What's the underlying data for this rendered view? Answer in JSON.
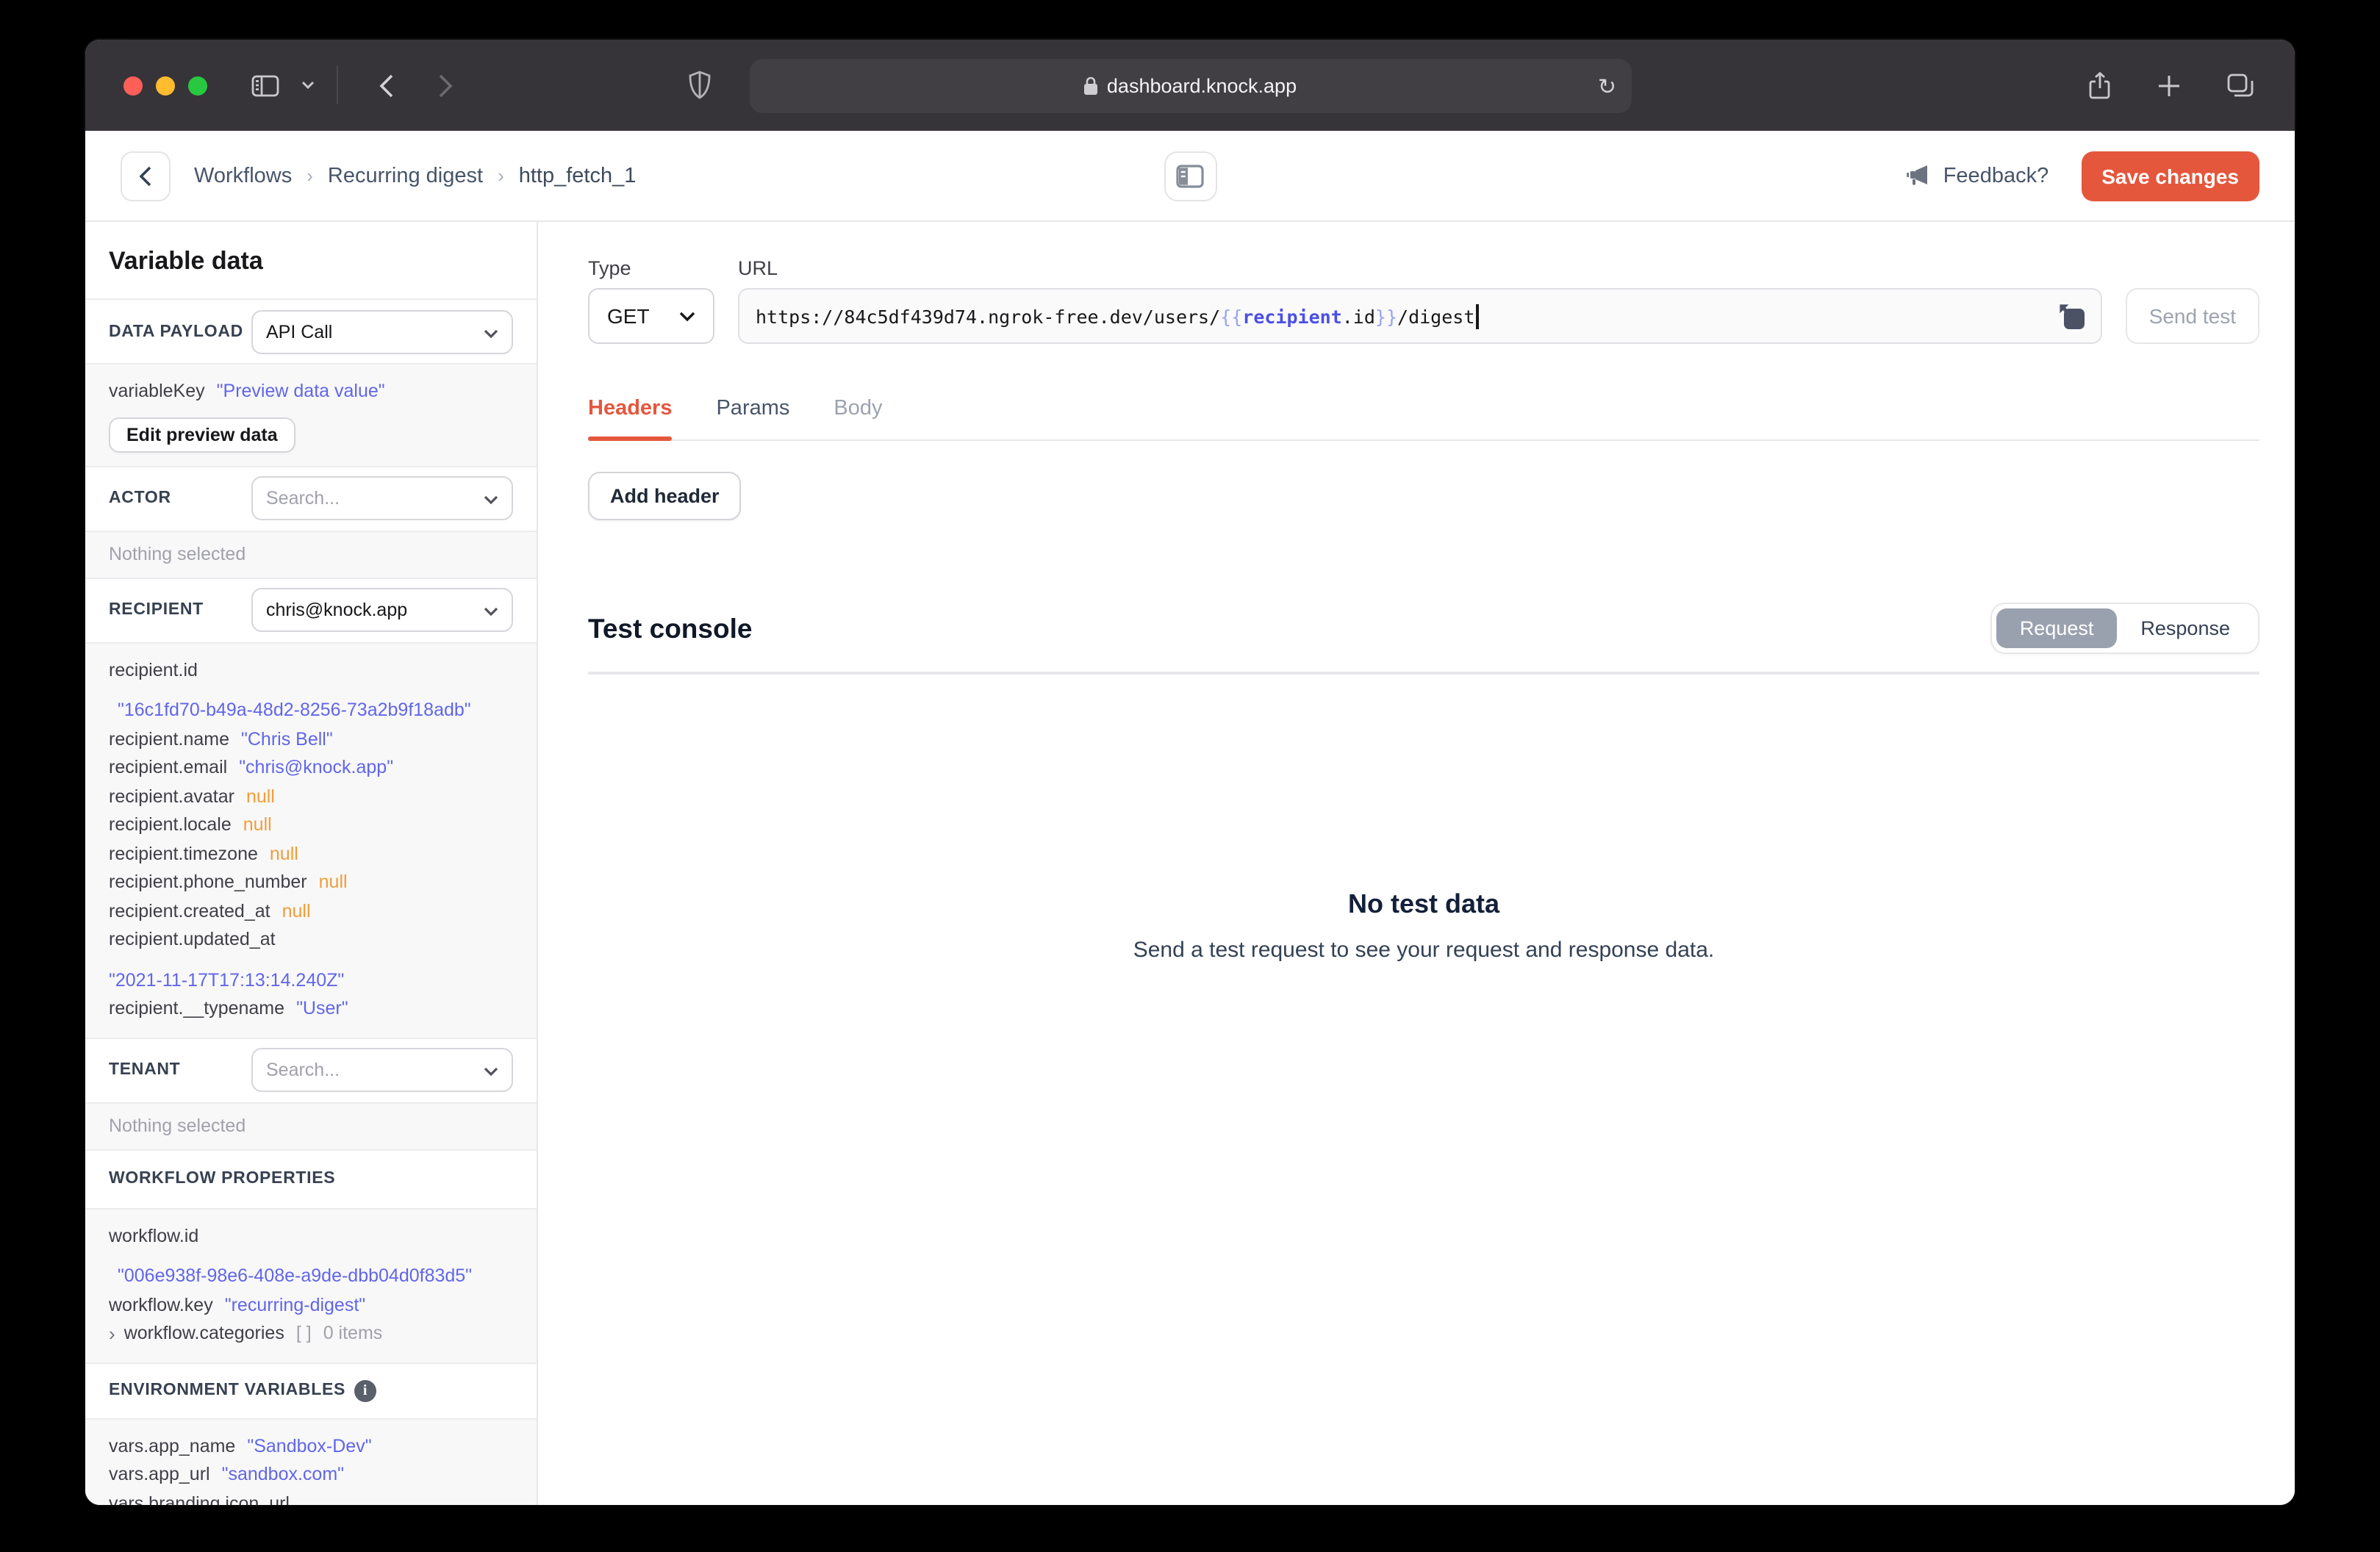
{
  "browser": {
    "url": "dashboard.knock.app"
  },
  "header": {
    "breadcrumb": [
      "Workflows",
      "Recurring digest",
      "http_fetch_1"
    ],
    "feedback_label": "Feedback?",
    "save_label": "Save changes"
  },
  "sidebar": {
    "title": "Variable data",
    "data_payload": {
      "label": "DATA PAYLOAD",
      "selected": "API Call"
    },
    "preview": {
      "key": "variableKey",
      "value": "\"Preview data value\"",
      "edit_button": "Edit preview data"
    },
    "actor": {
      "label": "ACTOR",
      "placeholder": "Search...",
      "empty": "Nothing selected"
    },
    "recipient": {
      "label": "RECIPIENT",
      "selected": "chris@knock.app",
      "fields": [
        {
          "k": "recipient.id",
          "v": "\"16c1fd70-b49a-48d2-8256-73a2b9f18adb\"",
          "type": "string",
          "wrap": true
        },
        {
          "k": "recipient.name",
          "v": "\"Chris Bell\"",
          "type": "string"
        },
        {
          "k": "recipient.email",
          "v": "\"chris@knock.app\"",
          "type": "string"
        },
        {
          "k": "recipient.avatar",
          "v": "null",
          "type": "null"
        },
        {
          "k": "recipient.locale",
          "v": "null",
          "type": "null"
        },
        {
          "k": "recipient.timezone",
          "v": "null",
          "type": "null"
        },
        {
          "k": "recipient.phone_number",
          "v": "null",
          "type": "null"
        },
        {
          "k": "recipient.created_at",
          "v": "null",
          "type": "null"
        },
        {
          "k": "recipient.updated_at",
          "v": "\"2021-11-17T17:13:14.240Z\"",
          "type": "string"
        },
        {
          "k": "recipient.__typename",
          "v": "\"User\"",
          "type": "string"
        }
      ]
    },
    "tenant": {
      "label": "TENANT",
      "placeholder": "Search...",
      "empty": "Nothing selected"
    },
    "workflow": {
      "label": "WORKFLOW PROPERTIES",
      "fields": [
        {
          "k": "workflow.id",
          "v": "\"006e938f-98e6-408e-a9de-dbb04d0f83d5\"",
          "type": "string",
          "wrap": true
        },
        {
          "k": "workflow.key",
          "v": "\"recurring-digest\"",
          "type": "string"
        },
        {
          "k": "workflow.categories",
          "prefix": "›",
          "v": "[ ]",
          "type": "array",
          "suffix": "0 items"
        }
      ]
    },
    "env": {
      "label": "ENVIRONMENT VARIABLES",
      "fields": [
        {
          "k": "vars.app_name",
          "v": "\"Sandbox-Dev\"",
          "type": "string"
        },
        {
          "k": "vars.app_url",
          "v": "\"sandbox.com\"",
          "type": "string"
        },
        {
          "k": "vars.branding.icon_url",
          "v": "",
          "type": "none"
        }
      ]
    }
  },
  "request": {
    "type_label": "Type",
    "type_value": "GET",
    "url_label": "URL",
    "url_parts": [
      {
        "t": "https://84c5df439d74.ngrok-free.dev/users/",
        "c": "plain"
      },
      {
        "t": "{{ ",
        "c": "brace"
      },
      {
        "t": "recipient",
        "c": "var"
      },
      {
        "t": ".id",
        "c": "plain"
      },
      {
        "t": " }}",
        "c": "brace"
      },
      {
        "t": "/digest",
        "c": "plain"
      }
    ],
    "send_test_label": "Send test",
    "tabs": [
      {
        "label": "Headers",
        "state": "active"
      },
      {
        "label": "Params",
        "state": "normal"
      },
      {
        "label": "Body",
        "state": "muted"
      }
    ],
    "add_header_label": "Add header"
  },
  "console": {
    "title": "Test console",
    "segments": [
      {
        "label": "Request",
        "active": true
      },
      {
        "label": "Response",
        "active": false
      }
    ],
    "empty_title": "No test data",
    "empty_subtitle": "Send a test request to see your request and response data."
  },
  "colors": {
    "accent_red": "#e4573d",
    "string_value": "#6166e8",
    "null_value": "#f29d38",
    "titlebar": "#373439"
  }
}
